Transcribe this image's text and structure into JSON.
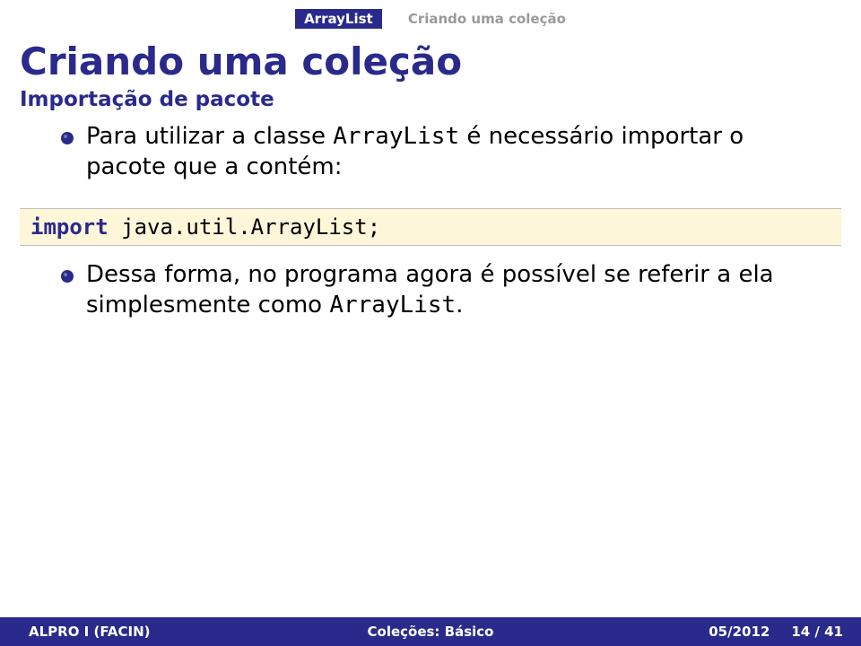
{
  "breadcrumb": {
    "section": "ArrayList",
    "subsection": "Criando uma coleção"
  },
  "title": "Criando uma coleção",
  "subtitle": "Importação de pacote",
  "bullet1": {
    "pre": "Para utilizar a classe ",
    "code": "ArrayList",
    "post": " é necessário importar o pacote que a contém:"
  },
  "code": {
    "keyword": "import",
    "rest": " java.util.ArrayList;"
  },
  "bullet2": {
    "pre": "Dessa forma, no programa agora é possível se referir a ela simplesmente como ",
    "code": "ArrayList",
    "post": "."
  },
  "footer": {
    "left": "ALPRO I (FACIN)",
    "center": "Coleções: Básico",
    "date": "05/2012",
    "page": "14 / 41"
  }
}
